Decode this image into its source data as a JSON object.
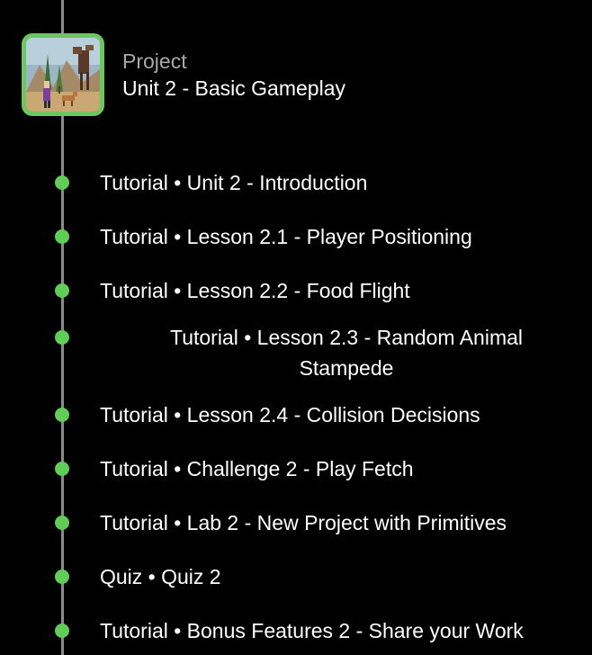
{
  "project": {
    "type_label": "Project",
    "title": "Unit 2 - Basic Gameplay",
    "thumbnail_icon": "game-scene-thumbnail"
  },
  "colors": {
    "background": "#000000",
    "accent_green": "#5fcd56",
    "timeline_line": "#8c8c8c",
    "muted_text": "#a8a8a8"
  },
  "items": [
    {
      "label": "Tutorial • Unit 2 - Introduction"
    },
    {
      "label": "Tutorial • Lesson 2.1 - Player Positioning"
    },
    {
      "label": "Tutorial • Lesson 2.2 - Food Flight"
    },
    {
      "label": "Tutorial • Lesson 2.3 - Random Animal Stampede"
    },
    {
      "label": "Tutorial • Lesson 2.4 - Collision Decisions"
    },
    {
      "label": "Tutorial • Challenge 2 - Play Fetch"
    },
    {
      "label": "Tutorial • Lab 2 - New Project with Primitives"
    },
    {
      "label": "Quiz • Quiz 2"
    },
    {
      "label": "Tutorial • Bonus Features 2 - Share your Work"
    }
  ]
}
